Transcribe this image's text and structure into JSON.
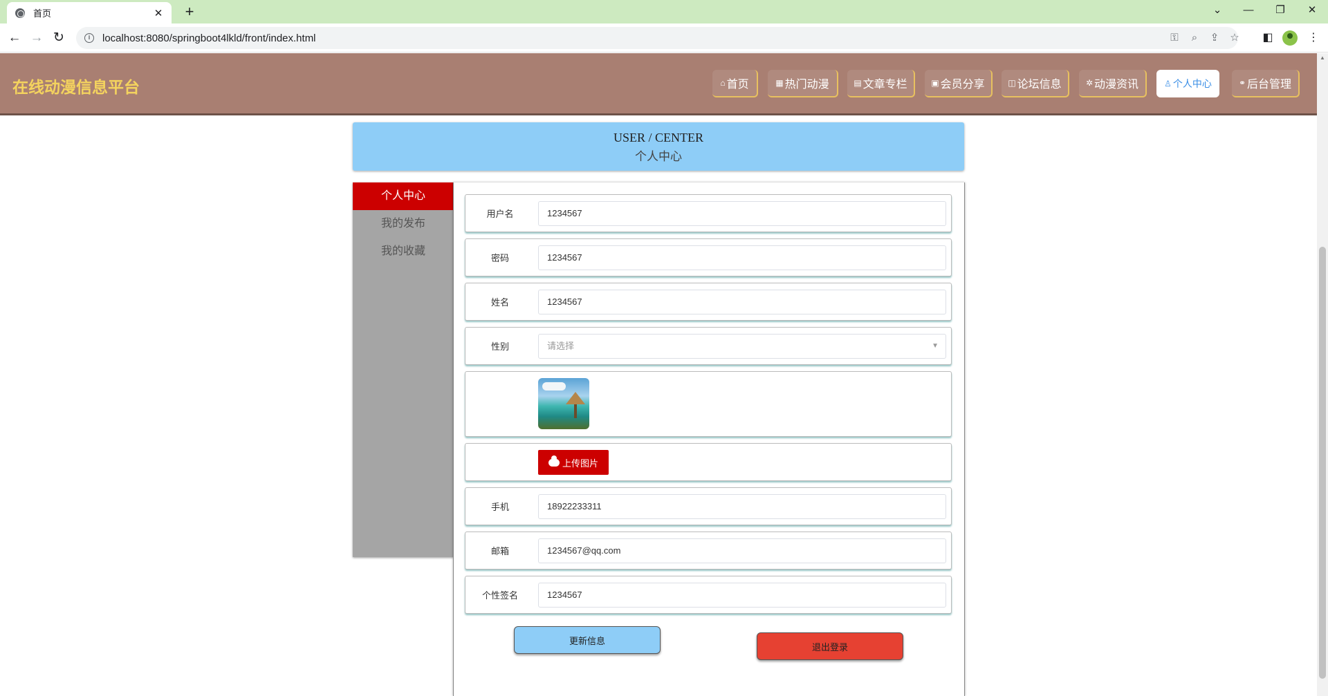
{
  "browser": {
    "tab_title": "首页",
    "tab_close": "✕",
    "new_tab": "+",
    "url": "localhost:8080/springboot4lkld/front/index.html"
  },
  "site": {
    "title": "在线动漫信息平台",
    "nav": [
      {
        "label": "首页",
        "icon": "⌂"
      },
      {
        "label": "热门动漫",
        "icon": "▦"
      },
      {
        "label": "文章专栏",
        "icon": "▤"
      },
      {
        "label": "会员分享",
        "icon": "▣"
      },
      {
        "label": "论坛信息",
        "icon": "◫"
      },
      {
        "label": "动漫资讯",
        "icon": "✲"
      },
      {
        "label": "个人中心",
        "icon": "♙"
      },
      {
        "label": "后台管理",
        "icon": "⚭"
      }
    ]
  },
  "banner": {
    "en": "USER / CENTER",
    "cn": "个人中心"
  },
  "side_menu": [
    {
      "label": "个人中心"
    },
    {
      "label": "我的发布"
    },
    {
      "label": "我的收藏"
    }
  ],
  "form": {
    "username": {
      "label": "用户名",
      "value": "1234567"
    },
    "password": {
      "label": "密码",
      "value": "1234567"
    },
    "name": {
      "label": "姓名",
      "value": "1234567"
    },
    "gender": {
      "label": "性别",
      "placeholder": "请选择"
    },
    "upload_label": "上传图片",
    "phone": {
      "label": "手机",
      "value": "18922233311"
    },
    "email": {
      "label": "邮箱",
      "value": "1234567@qq.com"
    },
    "signature": {
      "label": "个性签名",
      "value": "1234567"
    }
  },
  "actions": {
    "update": "更新信息",
    "logout": "退出登录"
  },
  "colors": {
    "header_bg": "#a97f72",
    "title_color": "#f4d35e",
    "banner_bg": "#8ecdf7",
    "active_red": "#cc0000",
    "logout_red": "#e64132"
  }
}
